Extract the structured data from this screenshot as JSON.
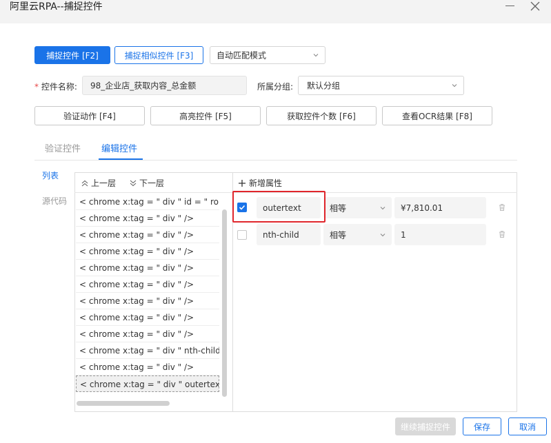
{
  "window": {
    "title": "阿里云RPA--捕捉控件"
  },
  "toolbar": {
    "capture_label": "捕捉控件 [F2]",
    "capture_similar_label": "捕捉相似控件 [F3]",
    "match_mode": "自动匹配模式"
  },
  "form": {
    "name_label": "控件名称:",
    "name_required_mark": "*",
    "name_value": "98_企业店_获取内容_总金额",
    "group_label": "所属分组:",
    "group_value": "默认分组"
  },
  "actions": {
    "verify_label": "验证动作 [F4]",
    "highlight_label": "高亮控件 [F5]",
    "count_label": "获取控件个数 [F6]",
    "ocr_label": "查看OCR结果 [F8]"
  },
  "tabs": {
    "verify": "验证控件",
    "edit": "编辑控件"
  },
  "side": {
    "list": "列表",
    "source": "源代码"
  },
  "tree": {
    "up_label": "上一层",
    "down_label": "下一层",
    "items": [
      "< chrome  x:tag = \" div \"  id = \" ro",
      "< chrome  x:tag = \" div \" />",
      "< chrome  x:tag = \" div \" />",
      "< chrome  x:tag = \" div \" />",
      "< chrome  x:tag = \" div \" />",
      "< chrome  x:tag = \" div \" />",
      "< chrome  x:tag = \" div \" />",
      "< chrome  x:tag = \" div \" />",
      "< chrome  x:tag = \" div \" />",
      "< chrome  x:tag = \" div \"  nth-child",
      "< chrome  x:tag = \" div \" />",
      "< chrome  x:tag = \" div \"  outertext"
    ]
  },
  "attributes": {
    "add_label": "新增属性",
    "rows": [
      {
        "checked": true,
        "name": "outertext",
        "operator": "相等",
        "value": "¥7,810.01"
      },
      {
        "checked": false,
        "name": "nth-child",
        "operator": "相等",
        "value": "1"
      }
    ]
  },
  "footer": {
    "continue_label": "继续捕捉控件",
    "save_label": "保存",
    "cancel_label": "取消"
  },
  "colors": {
    "accent": "#1a73e8",
    "highlight": "#e0252b"
  }
}
